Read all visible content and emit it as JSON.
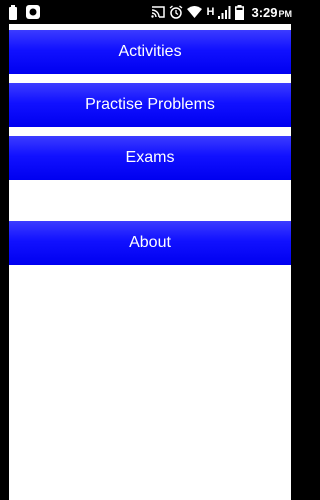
{
  "status_bar": {
    "network_type": "H",
    "time": "3:29",
    "time_suffix": "PM",
    "icons": [
      "battery-saver-icon",
      "notification-app-icon",
      "cast-icon",
      "alarm-icon",
      "wifi-icon",
      "signal-icon",
      "battery-icon"
    ]
  },
  "menu": {
    "activities_label": "Activities",
    "practise_label": "Practise Problems",
    "exams_label": "Exams",
    "about_label": "About"
  },
  "colors": {
    "button_blue": "#0000f0",
    "background": "#ffffff",
    "status_bar": "#000000"
  }
}
